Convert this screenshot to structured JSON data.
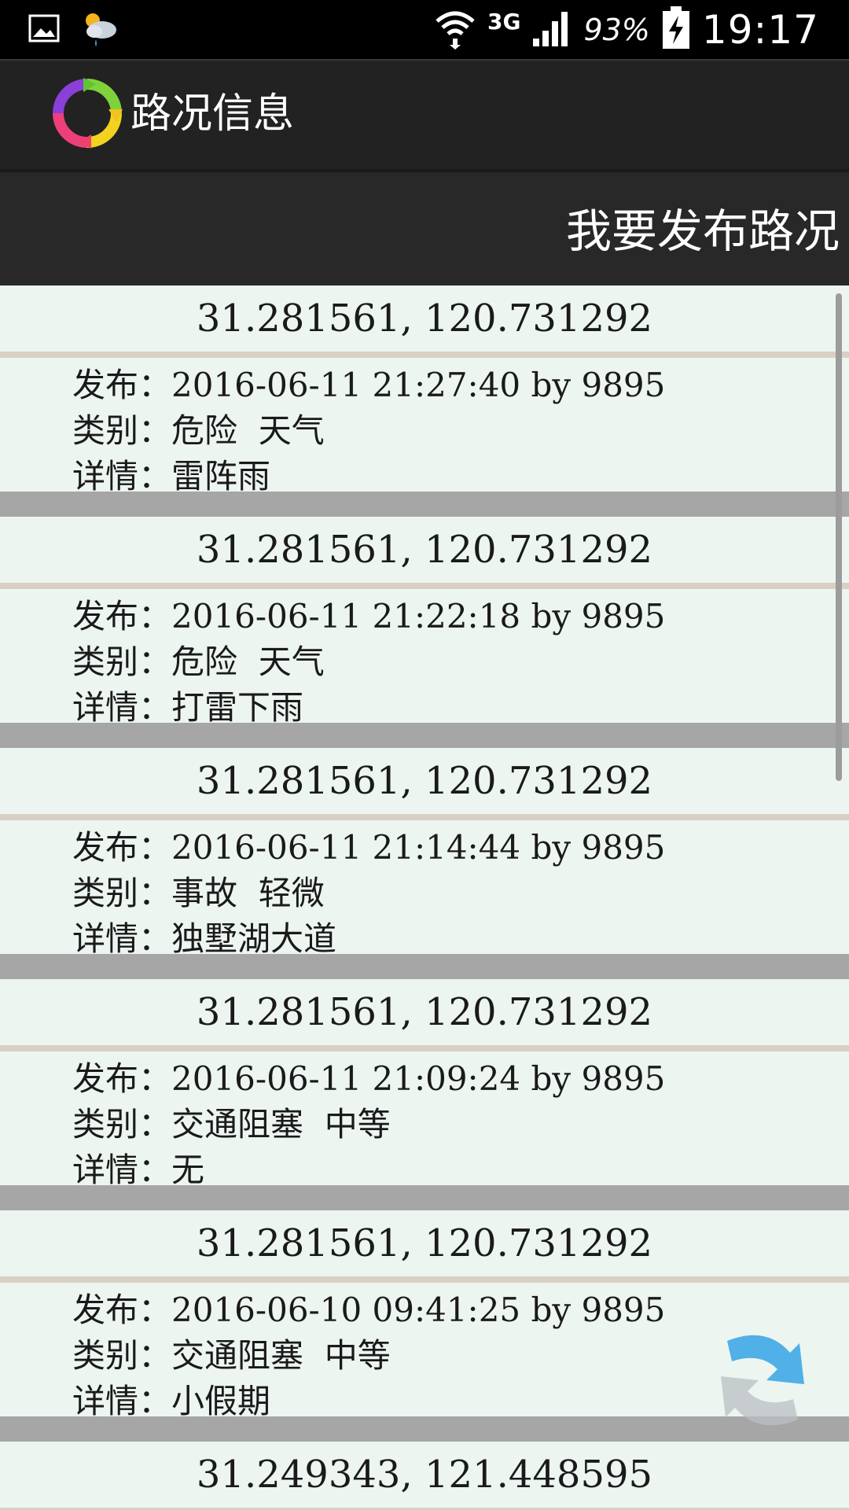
{
  "status_bar": {
    "battery": "93%",
    "network": "3G",
    "time": "19:17"
  },
  "app_bar": {
    "title": "路况信息"
  },
  "header": {
    "post_button": "我要发布路况"
  },
  "labels": {
    "publish": "发布：",
    "category": "类别：",
    "detail": "详情："
  },
  "items": [
    {
      "coords": "31.281561, 120.731292",
      "publish": "2016-06-11 21:27:40 by 9895",
      "category": "危险  天气",
      "detail": "雷阵雨"
    },
    {
      "coords": "31.281561, 120.731292",
      "publish": "2016-06-11 21:22:18 by 9895",
      "category": "危险  天气",
      "detail": "打雷下雨"
    },
    {
      "coords": "31.281561, 120.731292",
      "publish": "2016-06-11 21:14:44 by 9895",
      "category": "事故  轻微",
      "detail": "独墅湖大道"
    },
    {
      "coords": "31.281561, 120.731292",
      "publish": "2016-06-11 21:09:24 by 9895",
      "category": "交通阻塞  中等",
      "detail": "无"
    },
    {
      "coords": "31.281561, 120.731292",
      "publish": "2016-06-10 09:41:25 by 9895",
      "category": "交通阻塞  中等",
      "detail": "小假期"
    },
    {
      "coords": "31.249343, 121.448595"
    }
  ],
  "icons": {
    "gallery": "image-icon",
    "weather": "weather-icon",
    "wifi": "wifi-icon",
    "signal": "signal-icon",
    "battery": "battery-charging-icon",
    "app": "app-logo-icon",
    "refresh": "refresh-icon"
  }
}
